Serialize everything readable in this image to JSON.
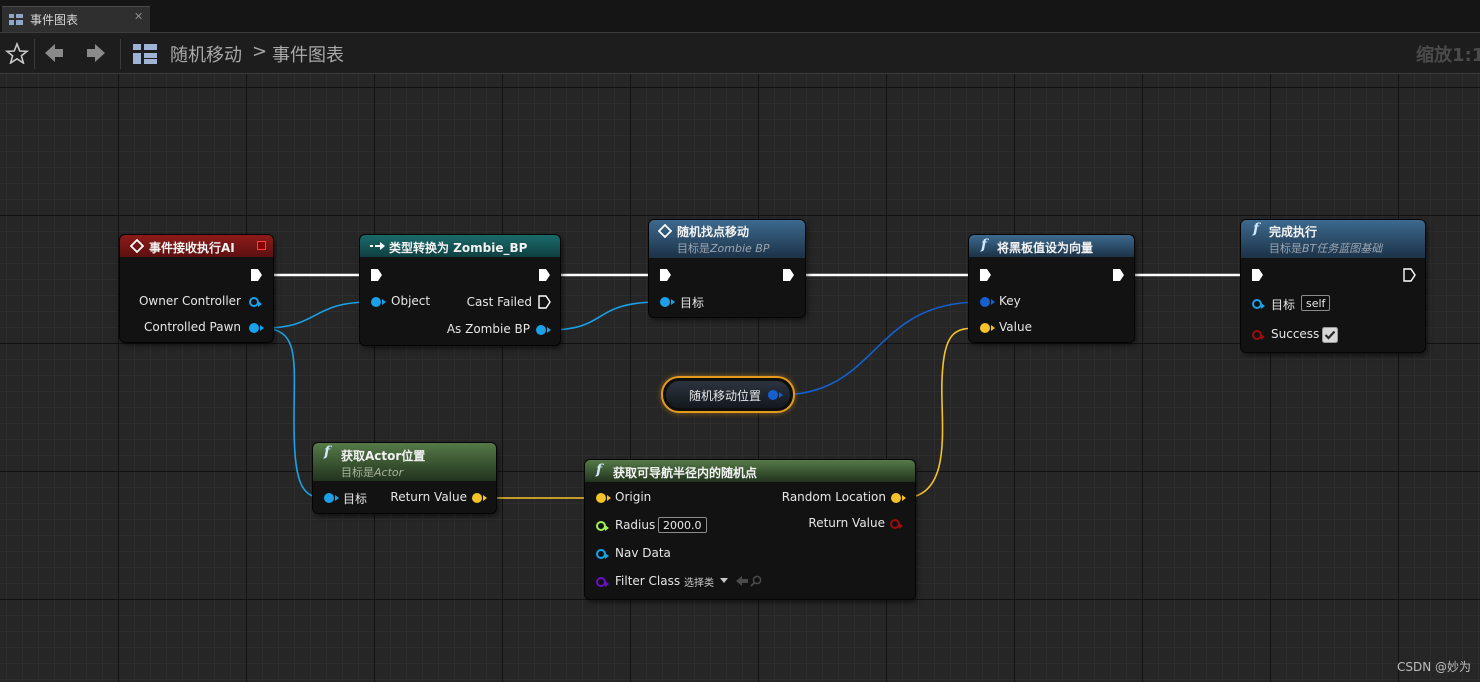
{
  "tab": {
    "label": "事件图表",
    "close": "✕"
  },
  "breadcrumb": {
    "parent": "随机移动",
    "separator": ">",
    "current": "事件图表"
  },
  "zoom_label": "缩放1:1",
  "nodes": {
    "event": {
      "title": "事件接收执行AI",
      "owner": "Owner Controller",
      "pawn": "Controlled Pawn"
    },
    "cast": {
      "title": "类型转换为 Zombie_BP",
      "object": "Object",
      "failed": "Cast Failed",
      "as_zombie": "As Zombie BP"
    },
    "random_move": {
      "title": "随机找点移动",
      "subtitle_prefix": "目标是",
      "subtitle_target": "Zombie BP",
      "target": "目标"
    },
    "set_bb": {
      "title": "将黑板值设为向量",
      "key": "Key",
      "value": "Value"
    },
    "finish": {
      "title": "完成执行",
      "subtitle_prefix": "目标是",
      "subtitle_target": "BT任务蓝图基础",
      "target": "目标",
      "target_value": "self",
      "success": "Success",
      "success_checked": true
    },
    "variable": {
      "label": "随机移动位置"
    },
    "get_actor": {
      "title": "获取Actor位置",
      "subtitle_prefix": "目标是",
      "subtitle_target": "Actor",
      "target": "目标",
      "return": "Return Value"
    },
    "nav": {
      "title": "获取可导航半径内的随机点",
      "origin": "Origin",
      "radius": "Radius",
      "radius_value": "2000.0",
      "nav_data": "Nav Data",
      "filter": "Filter Class",
      "filter_value": "选择类",
      "random_location": "Random Location",
      "return": "Return Value"
    }
  },
  "colors": {
    "exec": "#ffffff",
    "object_pin": "#1aa1e8",
    "vector_pin": "#f5c22a",
    "float_pin": "#9ef05a",
    "bool_pin": "#9b0d0d",
    "class_pin": "#6a10c0",
    "struct_key_pin": "#1460d0",
    "event_header": "#7a1414",
    "cast_header": "#155758",
    "func_header": "#254d6b",
    "pure_header": "#3d5c34",
    "variable_border": "#e39a1d"
  },
  "icons": {
    "tab": "blueprint-graph-icon",
    "favorite": "star-icon",
    "back": "arrow-left-icon",
    "forward": "arrow-right-icon",
    "graph": "blueprint-graph-icon",
    "function": "function-f-icon",
    "event": "event-diamond-icon",
    "cast": "cast-arrow-icon"
  },
  "watermark": "CSDN @妙为"
}
